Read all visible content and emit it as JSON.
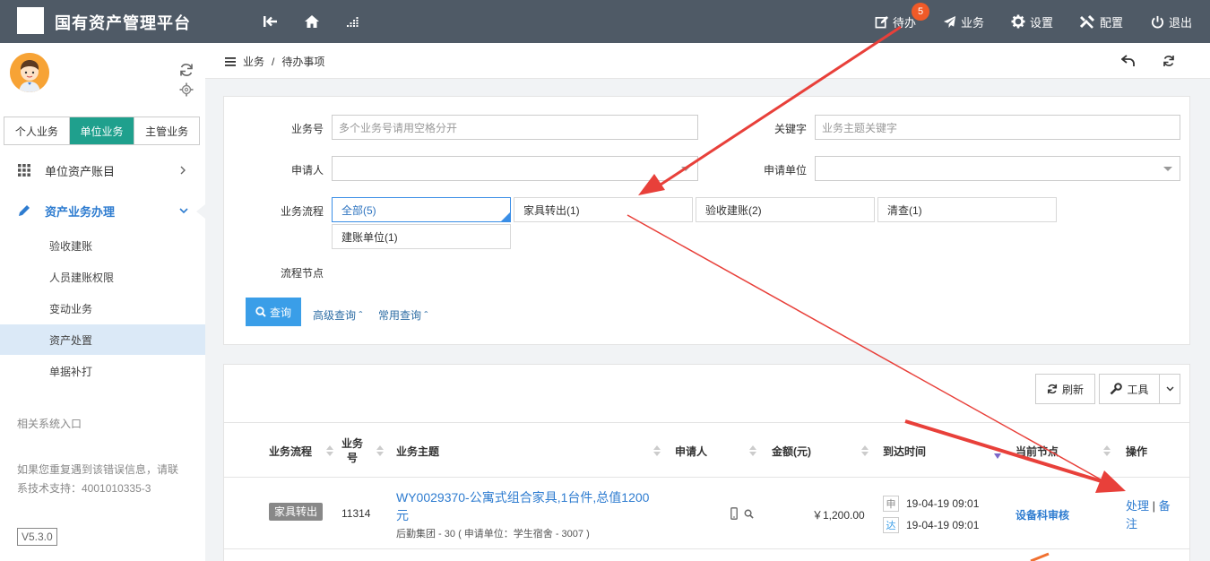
{
  "app": {
    "title": "国有资产管理平台"
  },
  "topnav": {
    "pending_label": "待办",
    "pending_count": "5",
    "business_label": "业务",
    "settings_label": "设置",
    "config_label": "配置",
    "logout_label": "退出"
  },
  "sidebar": {
    "tabs": [
      {
        "label": "个人业务",
        "active": false
      },
      {
        "label": "单位业务",
        "active": true
      },
      {
        "label": "主管业务",
        "active": false
      }
    ],
    "menu": [
      {
        "label": "单位资产账目"
      },
      {
        "label": "资产业务办理"
      }
    ],
    "submenu": [
      {
        "label": "验收建账"
      },
      {
        "label": "人员建账权限"
      },
      {
        "label": "变动业务"
      },
      {
        "label": "资产处置"
      },
      {
        "label": "单据补打"
      }
    ],
    "related_label": "相关系统入口",
    "help_line1": "如果您重复遇到该错误信息，请联",
    "help_line2": "系技术支持：4001010335-3",
    "version": "V5.3.0"
  },
  "breadcrumb": {
    "root": "业务",
    "sep": "/",
    "current": "待办事项"
  },
  "search": {
    "biz_no_label": "业务号",
    "biz_no_placeholder": "多个业务号请用空格分开",
    "keyword_label": "关键字",
    "keyword_placeholder": "业务主题关键字",
    "applicant_label": "申请人",
    "applicant_unit_label": "申请单位",
    "flow_label": "业务流程",
    "flows": [
      "全部(5)",
      "家具转出(1)",
      "验收建账(2)",
      "清查(1)",
      "建账单位(1)"
    ],
    "node_label": "流程节点",
    "query_label": "查询",
    "advanced_label": "高级查询",
    "common_label": "常用查询"
  },
  "table": {
    "refresh_label": "刷新",
    "tools_label": "工具",
    "headers": {
      "flow": "业务流程",
      "no_line1": "业务",
      "no_line2": "号",
      "subject": "业务主题",
      "applicant": "申请人",
      "amount": "金额(元)",
      "arrive": "到达时间",
      "node": "当前节点",
      "action": "操作"
    },
    "rows": [
      {
        "flow_tag": "家具转出",
        "no": "11314",
        "subject_line1": "WY0029370-公寓式组合家具,1台件,总值1200",
        "subject_line2": "元",
        "subject_sub": "后勤集团 - 30 ( 申请单位：学生宿舍 - 3007 )",
        "amount": "￥1,200.00",
        "date_char1": "申",
        "date1": "19-04-19 09:01",
        "date_char2": "达",
        "date2": "19-04-19 09:01",
        "node": "设备科审核",
        "action_handle": "处理",
        "action_sep": "|",
        "action_note_1": "备",
        "action_note_2": "注"
      }
    ]
  },
  "colors": {
    "topbar": "#4f5a66",
    "accent": "#1fa08d",
    "primary": "#3a9ee8",
    "badge": "#f05a28",
    "arrow": "#e8403a"
  }
}
